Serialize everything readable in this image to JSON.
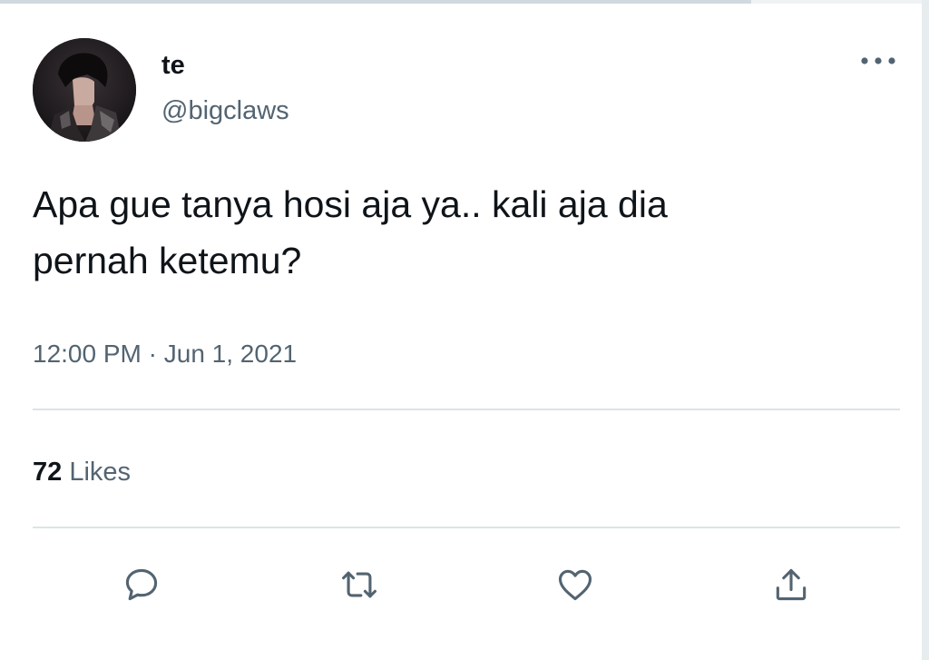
{
  "tweet": {
    "author": {
      "display_name": "te",
      "handle": "@bigclaws",
      "avatar_icon": "profile-photo"
    },
    "text": "Apa gue tanya hosi aja ya.. kali aja dia\npernah ketemu?",
    "timestamp": {
      "time": "12:00 PM",
      "separator": "·",
      "date": "Jun 1, 2021"
    },
    "stats": {
      "likes_count": "72",
      "likes_label": "Likes"
    },
    "actions": {
      "reply_icon": "reply-icon",
      "retweet_icon": "retweet-icon",
      "like_icon": "heart-icon",
      "share_icon": "share-icon",
      "more_icon": "more-options-icon"
    }
  },
  "colors": {
    "text_primary": "#0f1419",
    "text_secondary": "#536471",
    "divider": "#dde3e7"
  }
}
